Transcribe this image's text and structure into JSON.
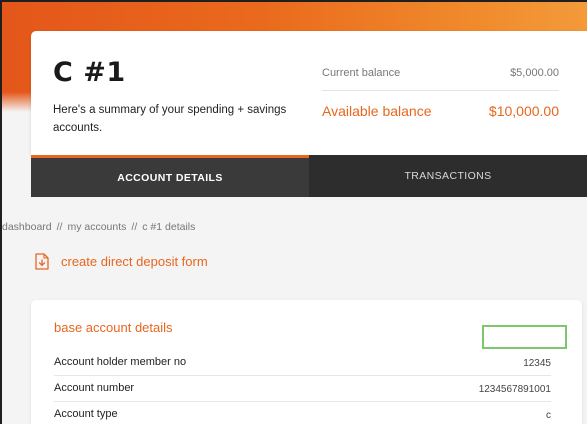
{
  "account": {
    "title": "C #1",
    "description": "Here's a summary of your spending + savings accounts."
  },
  "balances": {
    "current_label": "Current balance",
    "current_value": "$5,000.00",
    "available_label": "Available balance",
    "available_value": "$10,000.00"
  },
  "tabs": [
    {
      "label": "ACCOUNT DETAILS",
      "active": true
    },
    {
      "label": "TRANSACTIONS",
      "active": false
    }
  ],
  "breadcrumb": [
    "dashboard",
    "my accounts",
    "c #1 details"
  ],
  "breadcrumb_separator": "//",
  "deposit": {
    "label": "create direct deposit form",
    "icon": "download-document-icon"
  },
  "details": {
    "title": "base account details",
    "rows": [
      {
        "label": "Account holder member no",
        "value": "12345"
      },
      {
        "label": "Account number",
        "value": "1234567891001"
      },
      {
        "label": "Account type",
        "value": "c"
      }
    ]
  },
  "colors": {
    "accent": "#e8661e",
    "hero_start": "#e4561a",
    "hero_end": "#f39a3a",
    "tab_active_bg": "#3a3a3a",
    "tab_inactive_bg": "#2d2d2d",
    "highlight_box": "#7cc66b"
  }
}
